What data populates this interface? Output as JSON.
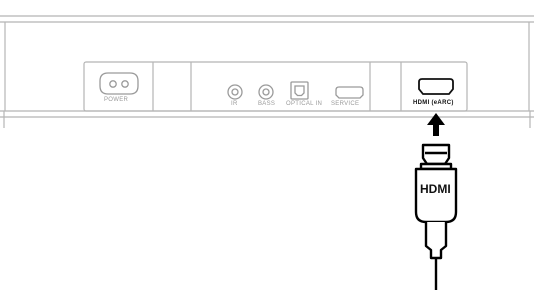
{
  "ports": {
    "power": "POWER",
    "ir": "IR",
    "bass": "BASS",
    "optical_in": "OPTICAL IN",
    "service": "SERVICE",
    "hdmi_earc": "HDMI (eARC)"
  },
  "cable": {
    "label": "HDMI"
  },
  "colors": {
    "line": "#1a1a1a",
    "port_gray": "#9a9a9a",
    "panel_line": "#b5b5b5"
  }
}
